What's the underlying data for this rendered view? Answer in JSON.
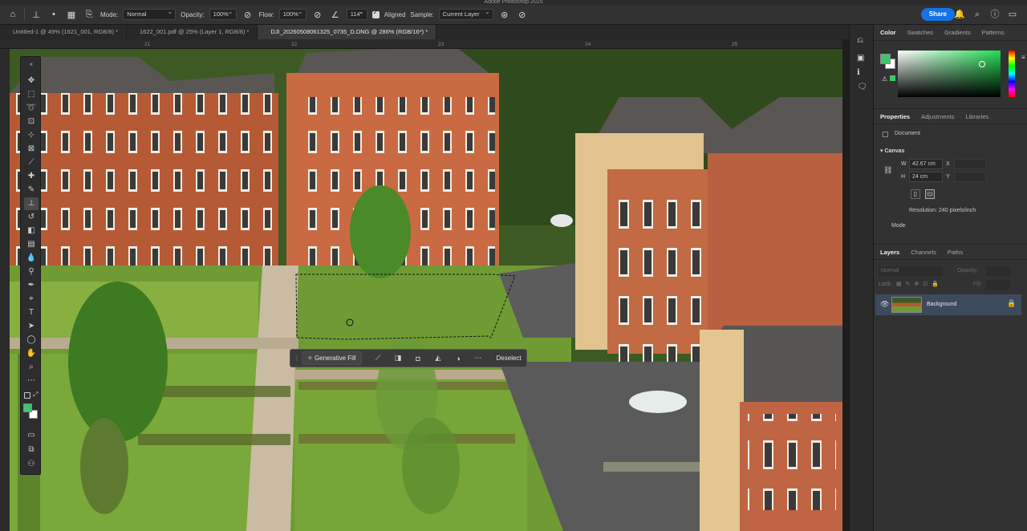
{
  "app": {
    "title": "Adobe Photoshop 2025"
  },
  "options_bar": {
    "mode_label": "Mode:",
    "mode_value": "Normal",
    "opacity_label": "Opacity:",
    "opacity_value": "100%",
    "flow_label": "Flow:",
    "flow_value": "100%",
    "angle_value": "114°",
    "aligned_label": "Aligned",
    "sample_label": "Sample:",
    "sample_value": "Current Layer",
    "share_label": "Share"
  },
  "tabs": [
    {
      "label": "Untitled-1 @ 49% (1621_001, RGB/8) *"
    },
    {
      "label": "1622_001.pdf @ 25% (Layer 1, RGB/8) *"
    },
    {
      "label": "DJI_20260508061325_0735_D.DNG @ 286% (RGB/16*) *"
    }
  ],
  "ruler": {
    "ticks": [
      "21",
      "22",
      "23",
      "24",
      "25"
    ]
  },
  "context_bar": {
    "generative_fill": "Generative Fill",
    "deselect": "Deselect"
  },
  "color_panel": {
    "tabs": [
      "Color",
      "Swatches",
      "Gradients",
      "Patterns"
    ],
    "foreground": "#3ec66a",
    "background": "#ffffff"
  },
  "properties_panel": {
    "tabs": [
      "Properties",
      "Adjustments",
      "Libraries"
    ],
    "document_label": "Document",
    "canvas_label": "Canvas",
    "width_label": "W",
    "width_value": "42.67 cm",
    "height_label": "H",
    "height_value": "24 cm",
    "x_label": "X",
    "y_label": "Y",
    "resolution": "Resolution: 240 pixels/inch",
    "mode_label": "Mode"
  },
  "layers_panel": {
    "tabs": [
      "Layers",
      "Channels",
      "Paths"
    ],
    "blend_mode": "Normal",
    "opacity_label": "Opacity:",
    "lock_label": "Lock:",
    "fill_label": "Fill:",
    "layer_name": "Background"
  }
}
